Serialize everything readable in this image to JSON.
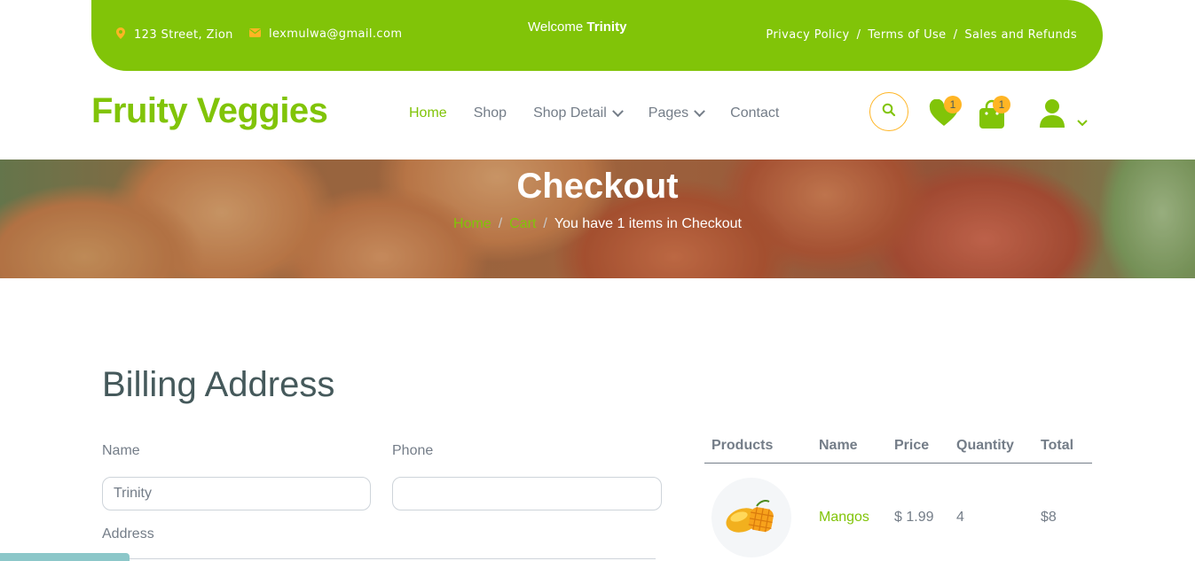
{
  "topbar": {
    "address": "123 Street, Zion",
    "email": "lexmulwa@gmail.com",
    "welcome_prefix": "Welcome",
    "welcome_user": "Trinity",
    "links": [
      "Privacy Policy",
      "Terms of Use",
      "Sales and Refunds"
    ],
    "separator": "/"
  },
  "brand": "Fruity Veggies",
  "nav": {
    "items": [
      {
        "label": "Home",
        "active": true
      },
      {
        "label": "Shop"
      },
      {
        "label": "Shop Detail",
        "dropdown": true
      },
      {
        "label": "Pages",
        "dropdown": true
      },
      {
        "label": "Contact"
      }
    ]
  },
  "icons": {
    "wishlist_count": "1",
    "cart_count": "1"
  },
  "hero": {
    "title": "Checkout",
    "breadcrumb": {
      "home": "Home",
      "cart": "Cart",
      "current": "You have 1 items in Checkout",
      "separator": "/"
    }
  },
  "billing": {
    "title": "Billing Address",
    "name_label": "Name",
    "name_value": "Trinity",
    "phone_label": "Phone",
    "phone_value": "",
    "address_label": "Address"
  },
  "order": {
    "headers": [
      "Products",
      "Name",
      "Price",
      "Quantity",
      "Total"
    ],
    "rows": [
      {
        "name": "Mangos",
        "price": "$ 1.99",
        "quantity": "4",
        "total": "$8"
      }
    ]
  },
  "colors": {
    "primary": "#81c408",
    "secondary": "#ffb524",
    "text": "#45595b",
    "muted": "#747d88"
  }
}
